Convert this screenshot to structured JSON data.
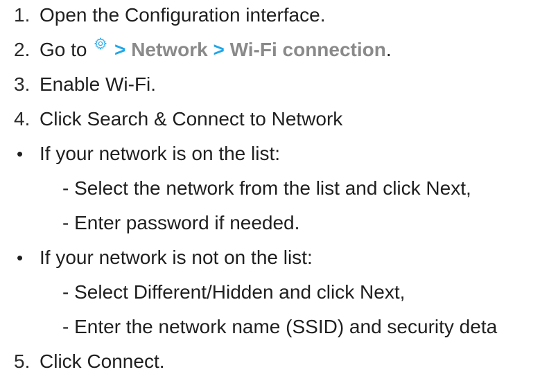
{
  "steps": [
    {
      "number": "1.",
      "text": "Open the Configuration interface."
    },
    {
      "number": "2.",
      "prefix": "Go to",
      "path": [
        "Network",
        "Wi-Fi connection"
      ],
      "separator": ">",
      "suffix": ".",
      "icon": "gear-icon"
    },
    {
      "number": "3.",
      "text": "Enable Wi-Fi."
    },
    {
      "number": "4.",
      "text": "Click Search & Connect to Network"
    },
    {
      "number": "5.",
      "text": "Click Connect."
    }
  ],
  "bullets": [
    {
      "symbol": "•",
      "text": "If your network is on the list:",
      "items": [
        "- Select the network from the list and click Next,",
        "- Enter password if needed."
      ]
    },
    {
      "symbol": "•",
      "text": "If your network is not on the list:",
      "items": [
        "- Select Different/Hidden and click Next,",
        "- Enter the network name (SSID) and security deta"
      ]
    }
  ],
  "colors": {
    "text": "#1f1f1f",
    "accent_path": "#8a8a8a",
    "separator": "#22a6e8"
  }
}
